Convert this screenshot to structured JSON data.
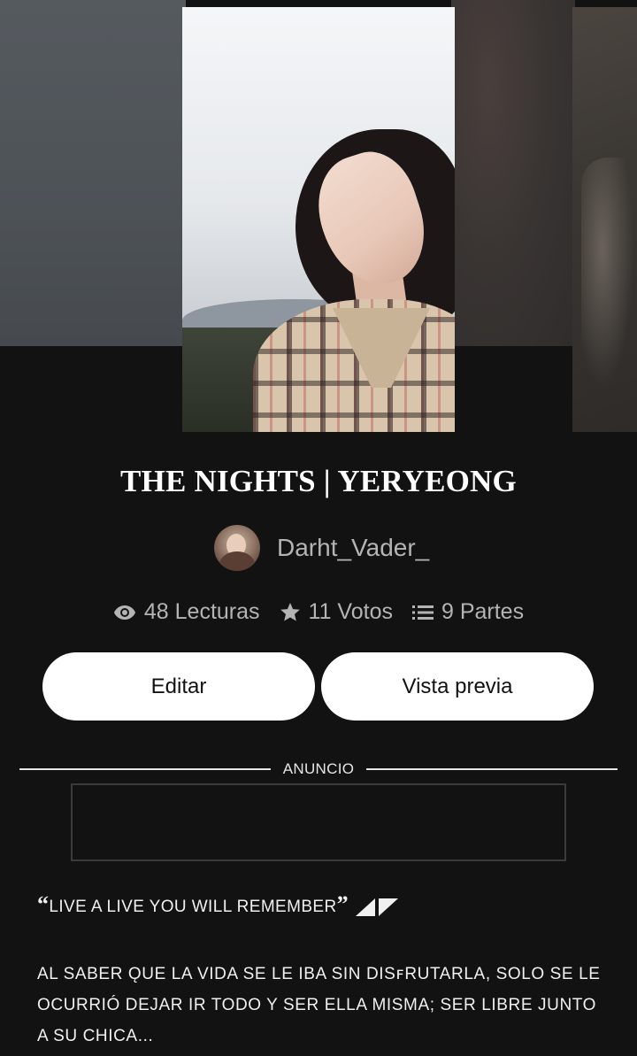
{
  "story": {
    "title": "THE NIGHTS | YERYEONG",
    "author": "Darht_Vader_",
    "stats": {
      "reads": "48 Lecturas",
      "votes": "11 Votos",
      "parts": "9 Partes"
    }
  },
  "actions": {
    "edit_label": "Editar",
    "preview_label": "Vista previa"
  },
  "ad": {
    "label": "ANUNCIO"
  },
  "description": {
    "quote_open": "“",
    "quote_text": "LIVE A LIVE YOU WILL REMEMBER",
    "quote_close": "”",
    "body": "AL SABER ǪUE LA VIDA SE LE IBA SIN DISꜰRUTARLA, SOLO SE LE OCURRIÓ DEJAR IR TODO Y SER ELLA MISMA; SER LIBRE JUNTO A SU CHICA..."
  },
  "icons": {
    "reads": "eye-icon",
    "votes": "star-icon",
    "parts": "list-icon"
  },
  "colors": {
    "background": "#121212",
    "button": "#ffffff",
    "muted_text": "#b4b4b4"
  }
}
